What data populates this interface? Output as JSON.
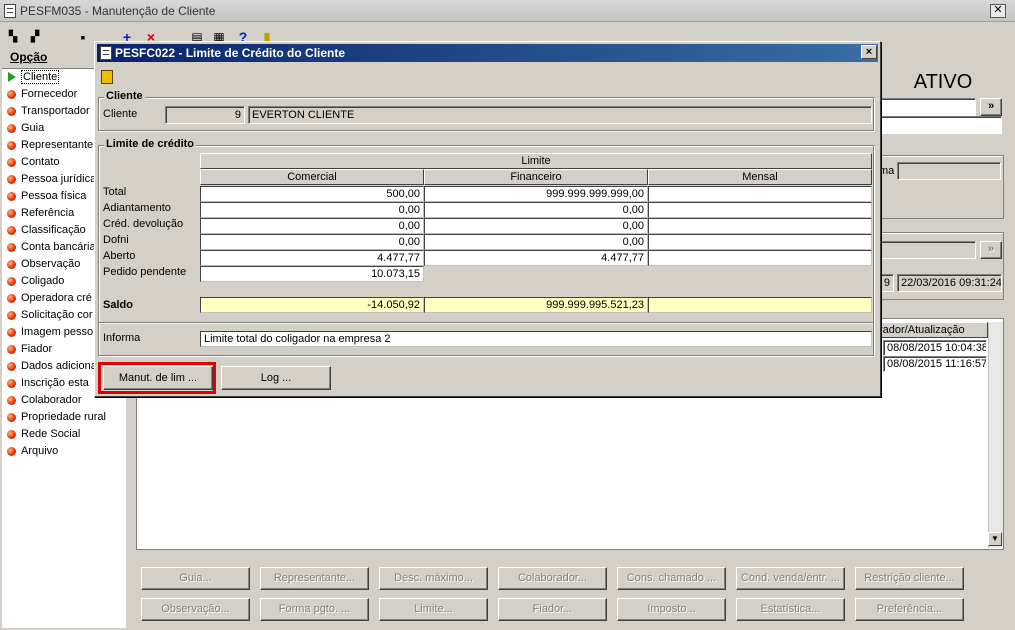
{
  "window": {
    "title": "PESFM035 - Manutenção de Cliente"
  },
  "left_panel": {
    "heading": "Opção",
    "items": [
      {
        "label": "Cliente"
      },
      {
        "label": "Fornecedor"
      },
      {
        "label": "Transportador"
      },
      {
        "label": "Guia"
      },
      {
        "label": "Representante"
      },
      {
        "label": "Contato"
      },
      {
        "label": "Pessoa jurídica"
      },
      {
        "label": "Pessoa física"
      },
      {
        "label": "Referência"
      },
      {
        "label": "Classificação"
      },
      {
        "label": "Conta bancária"
      },
      {
        "label": "Observação"
      },
      {
        "label": "Coligado"
      },
      {
        "label": "Operadora cré"
      },
      {
        "label": "Solicitação cor"
      },
      {
        "label": "Imagem pesso"
      },
      {
        "label": "Fiador"
      },
      {
        "label": "Dados adiciona"
      },
      {
        "label": "Inscrição esta"
      },
      {
        "label": "Colaborador"
      },
      {
        "label": "Propriedade rural"
      },
      {
        "label": "Rede Social"
      },
      {
        "label": "Arquivo"
      }
    ]
  },
  "background": {
    "status": "ATIVO",
    "nav_button": "»",
    "label_ma": "ma",
    "timestamp_field": "22/03/2016 09:31:24",
    "partial_field": "9",
    "grid_header": "rador/Atualização",
    "grid_rows": [
      "08/08/2015 10:04:38",
      "08/08/2015 11:16:57"
    ],
    "buttons_row1": [
      "Guia...",
      "Representante...",
      "Desc. máximo...",
      "Colaborador...",
      "Cons. chamado ...",
      "Cond. venda/entr. ...",
      "Restrição cliente..."
    ],
    "buttons_row2": [
      "Observação...",
      "Forma pgto. ...",
      "Limite...",
      "Fiador...",
      "Imposto...",
      "Estatística...",
      "Preferência..."
    ]
  },
  "dialog": {
    "title": "PESFC022 - Limite de Crédito do Cliente",
    "cliente_group": "Cliente",
    "cliente_label": "Cliente",
    "cliente_code": "9",
    "cliente_name": "EVERTON CLIENTE",
    "limite_group": "Limite de  crédito",
    "limite_header": "Limite",
    "col_headers": [
      "Comercial",
      "Financeiro",
      "Mensal"
    ],
    "rows": [
      {
        "label": "Total",
        "comercial": "500,00",
        "financeiro": "999.999.999.999,00",
        "mensal": ""
      },
      {
        "label": "Adiantamento",
        "comercial": "0,00",
        "financeiro": "0,00",
        "mensal": ""
      },
      {
        "label": "Créd. devolução",
        "comercial": "0,00",
        "financeiro": "0,00",
        "mensal": ""
      },
      {
        "label": "Dofni",
        "comercial": "0,00",
        "financeiro": "0,00",
        "mensal": ""
      },
      {
        "label": "Aberto",
        "comercial": "4.477,77",
        "financeiro": "4.477,77",
        "mensal": ""
      },
      {
        "label": "Pedido pendente",
        "comercial": "10.073,15"
      }
    ],
    "saldo": {
      "label": "Saldo",
      "comercial": "-14.050,92",
      "financeiro": "999.999.995.521,23",
      "mensal": ""
    },
    "informa_label": "Informa",
    "informa_value": "Limite total do coligador na empresa 2",
    "btn_manut": "Manut. de lim ...",
    "btn_log": "Log ...",
    "close_glyph": "×"
  },
  "colors": {
    "title_bar": "#0a246a",
    "highlight_frame": "#e00000",
    "saldo_bg": "#ffffc0"
  }
}
